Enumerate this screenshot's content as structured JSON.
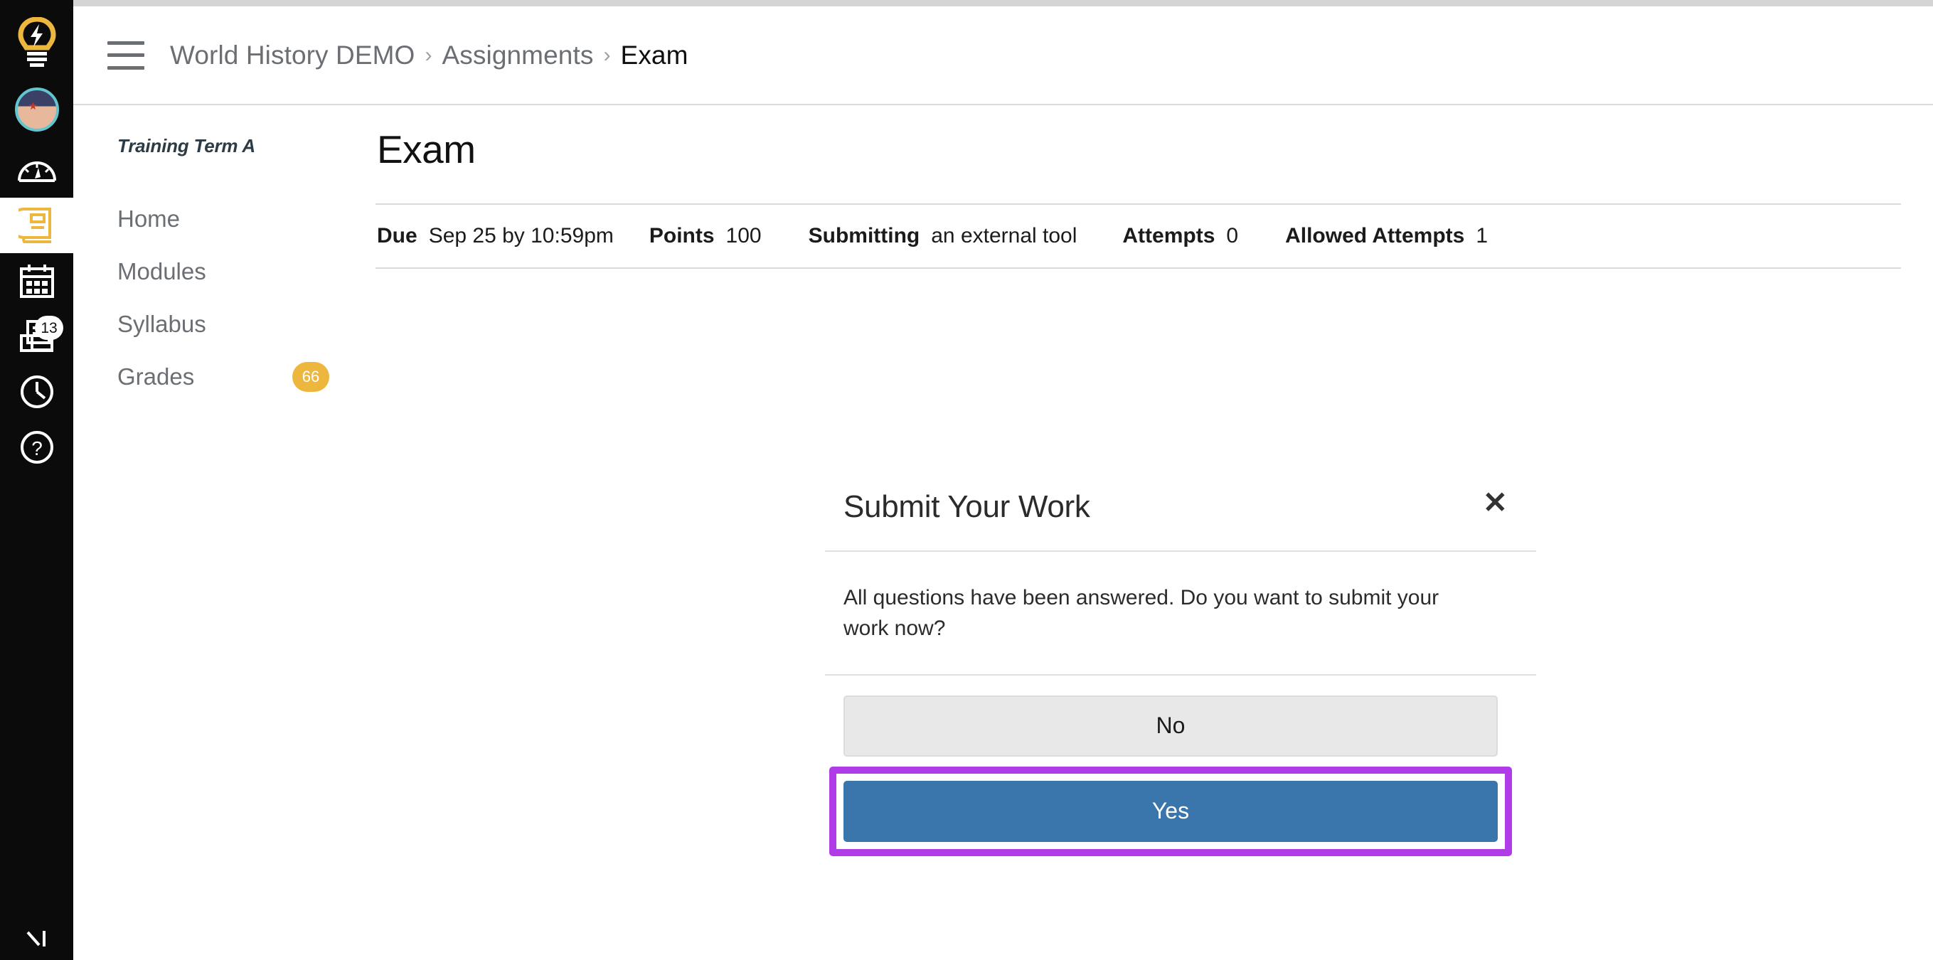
{
  "global_nav": {
    "items": [
      {
        "name": "logo",
        "icon": "lightbulb-icon",
        "label": "Dashboard Logo"
      },
      {
        "name": "account",
        "icon": "avatar-icon",
        "label": "Account"
      },
      {
        "name": "dashboard",
        "icon": "dashboard-gauge-icon",
        "label": "Dashboard"
      },
      {
        "name": "courses",
        "icon": "book-icon",
        "label": "Courses",
        "active": true
      },
      {
        "name": "calendar",
        "icon": "calendar-icon",
        "label": "Calendar"
      },
      {
        "name": "inbox",
        "icon": "inbox-icon",
        "label": "Inbox",
        "badge": "13"
      },
      {
        "name": "history",
        "icon": "clock-icon",
        "label": "History"
      },
      {
        "name": "help",
        "icon": "question-circle-icon",
        "label": "Help"
      },
      {
        "name": "collapse",
        "icon": "collapse-arrow-icon",
        "label": "Collapse"
      }
    ],
    "colors": {
      "background": "#0b0b0b",
      "accent": "#edb73e",
      "avatar_ring": "#62c6cf",
      "badge_bg": "#ffffff"
    }
  },
  "header": {
    "menu_icon": "hamburger-menu-icon",
    "breadcrumb": [
      {
        "label": "World History DEMO",
        "current": false
      },
      {
        "label": "Assignments",
        "current": false
      },
      {
        "label": "Exam",
        "current": true
      }
    ],
    "separator": "›"
  },
  "course_nav": {
    "term": "Training Term A",
    "items": [
      {
        "label": "Home",
        "badge": null
      },
      {
        "label": "Modules",
        "badge": null
      },
      {
        "label": "Syllabus",
        "badge": null
      },
      {
        "label": "Grades",
        "badge": "66"
      }
    ],
    "badge_color": "#edb73e"
  },
  "assignment": {
    "title": "Exam",
    "meta": [
      {
        "key": "Due",
        "value": "Sep 25 by 10:59pm"
      },
      {
        "key": "Points",
        "value": "100"
      },
      {
        "key": "Submitting",
        "value": "an external tool"
      },
      {
        "key": "Attempts",
        "value": "0"
      },
      {
        "key": "Allowed Attempts",
        "value": "1"
      }
    ]
  },
  "modal": {
    "title": "Submit Your Work",
    "close_icon": "close-x-icon",
    "close_label": "✕",
    "message": "All questions have been answered. Do you want to submit your work now?",
    "buttons": {
      "no_label": "No",
      "yes_label": "Yes"
    },
    "highlight_color": "#b03ce8",
    "primary_color": "#3a75ac",
    "secondary_color": "#e8e8e8"
  }
}
